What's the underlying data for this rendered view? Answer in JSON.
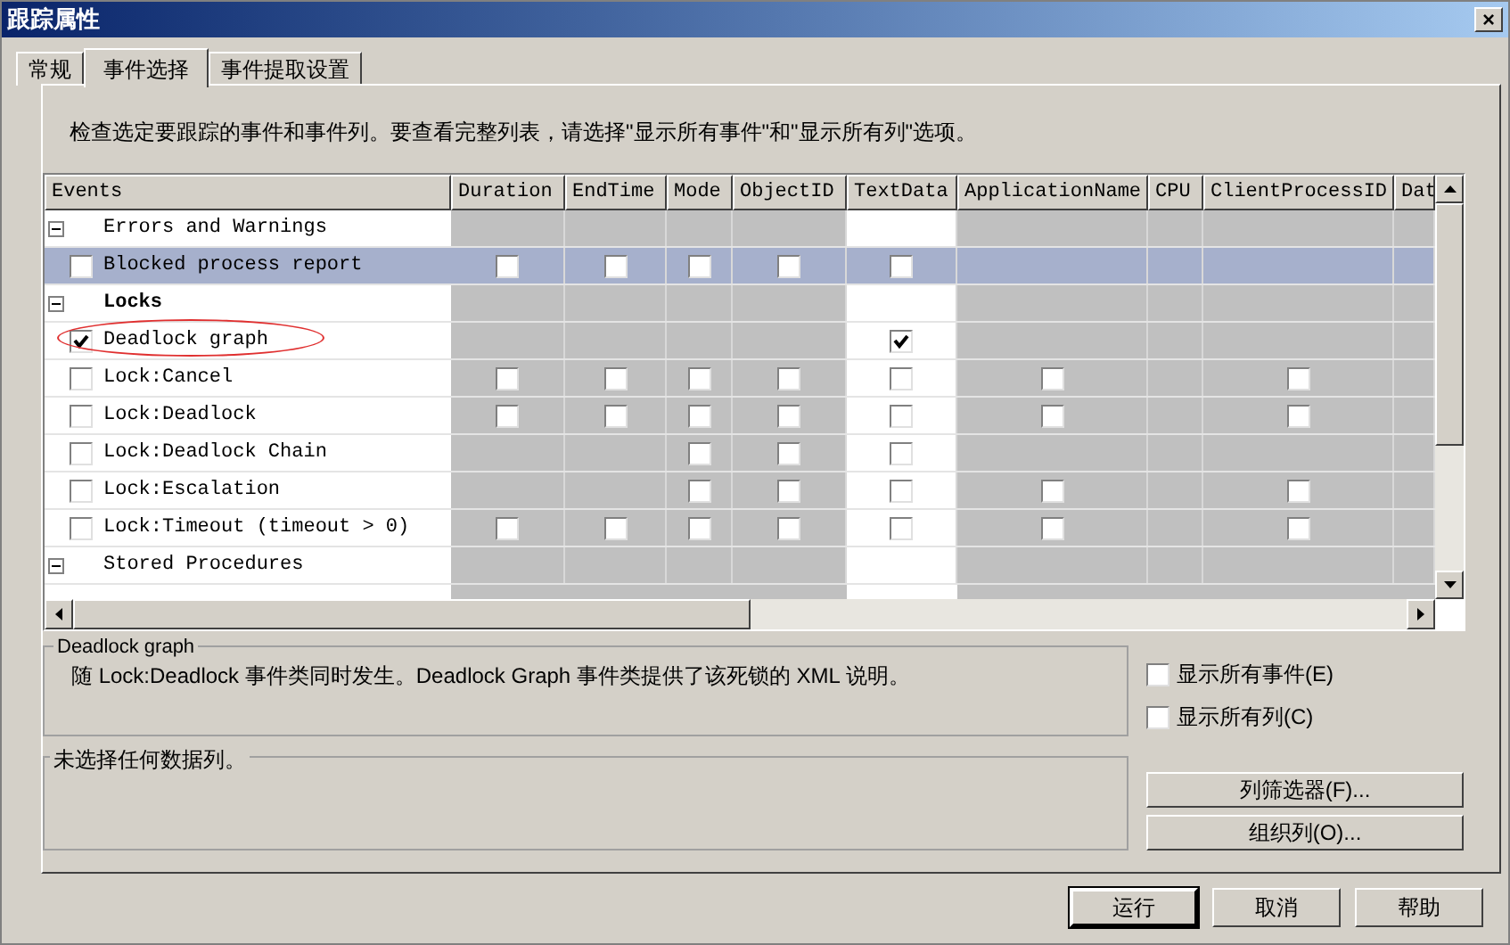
{
  "window": {
    "title": "跟踪属性",
    "close": "×"
  },
  "tabs": [
    {
      "label": "常规",
      "selected": false
    },
    {
      "label": "事件选择",
      "selected": true
    },
    {
      "label": "事件提取设置",
      "selected": false
    }
  ],
  "instructions": "检查选定要跟踪的事件和事件列。要查看完整列表，请选择\"显示所有事件\"和\"显示所有列\"选项。",
  "table": {
    "columns": [
      {
        "label": "Events",
        "highlighted": true
      },
      {
        "label": "Duration",
        "highlighted": false
      },
      {
        "label": "EndTime",
        "highlighted": false
      },
      {
        "label": "Mode",
        "highlighted": false
      },
      {
        "label": "ObjectID",
        "highlighted": false
      },
      {
        "label": "TextData",
        "highlighted": true
      },
      {
        "label": "ApplicationName",
        "highlighted": false
      },
      {
        "label": "CPU",
        "highlighted": false
      },
      {
        "label": "ClientProcessID",
        "highlighted": false
      },
      {
        "label": "Dat",
        "highlighted": false
      }
    ],
    "rows": [
      {
        "kind": "category",
        "label": "Errors and Warnings",
        "bold": false,
        "expanded": true
      },
      {
        "kind": "event",
        "label": "Blocked process report",
        "checked": false,
        "selected": true,
        "circled": false,
        "cells": [
          false,
          false,
          false,
          false,
          false,
          null,
          null,
          null,
          null
        ]
      },
      {
        "kind": "category",
        "label": "Locks",
        "bold": true,
        "expanded": true
      },
      {
        "kind": "event",
        "label": "Deadlock graph",
        "checked": true,
        "selected": false,
        "circled": true,
        "cells": [
          null,
          null,
          null,
          null,
          true,
          null,
          null,
          null,
          null
        ]
      },
      {
        "kind": "event",
        "label": "Lock:Cancel",
        "checked": false,
        "selected": false,
        "circled": false,
        "cells": [
          false,
          false,
          false,
          false,
          false,
          false,
          null,
          false,
          null
        ]
      },
      {
        "kind": "event",
        "label": "Lock:Deadlock",
        "checked": false,
        "selected": false,
        "circled": false,
        "cells": [
          false,
          false,
          false,
          false,
          false,
          false,
          null,
          false,
          null
        ]
      },
      {
        "kind": "event",
        "label": "Lock:Deadlock Chain",
        "checked": false,
        "selected": false,
        "circled": false,
        "cells": [
          null,
          null,
          false,
          false,
          false,
          null,
          null,
          null,
          null
        ]
      },
      {
        "kind": "event",
        "label": "Lock:Escalation",
        "checked": false,
        "selected": false,
        "circled": false,
        "cells": [
          null,
          null,
          false,
          false,
          false,
          false,
          null,
          false,
          null
        ]
      },
      {
        "kind": "event",
        "label": "Lock:Timeout (timeout > 0)",
        "checked": false,
        "selected": false,
        "circled": false,
        "cells": [
          false,
          false,
          false,
          false,
          false,
          false,
          null,
          false,
          null
        ]
      },
      {
        "kind": "category",
        "label": "Stored Procedures",
        "bold": false,
        "expanded": true
      }
    ]
  },
  "description": {
    "title": "Deadlock graph",
    "text": "随 Lock:Deadlock 事件类同时发生。Deadlock Graph 事件类提供了该死锁的 XML 说明。"
  },
  "data_columns": {
    "title": "未选择任何数据列。"
  },
  "options": [
    {
      "label": "显示所有事件(E)",
      "checked": false
    },
    {
      "label": "显示所有列(C)",
      "checked": false
    }
  ],
  "side_buttons": [
    "列筛选器(F)...",
    "组织列(O)..."
  ],
  "buttons": [
    {
      "label": "运行",
      "default": true
    },
    {
      "label": "取消",
      "default": false
    },
    {
      "label": "帮助",
      "default": false
    }
  ]
}
